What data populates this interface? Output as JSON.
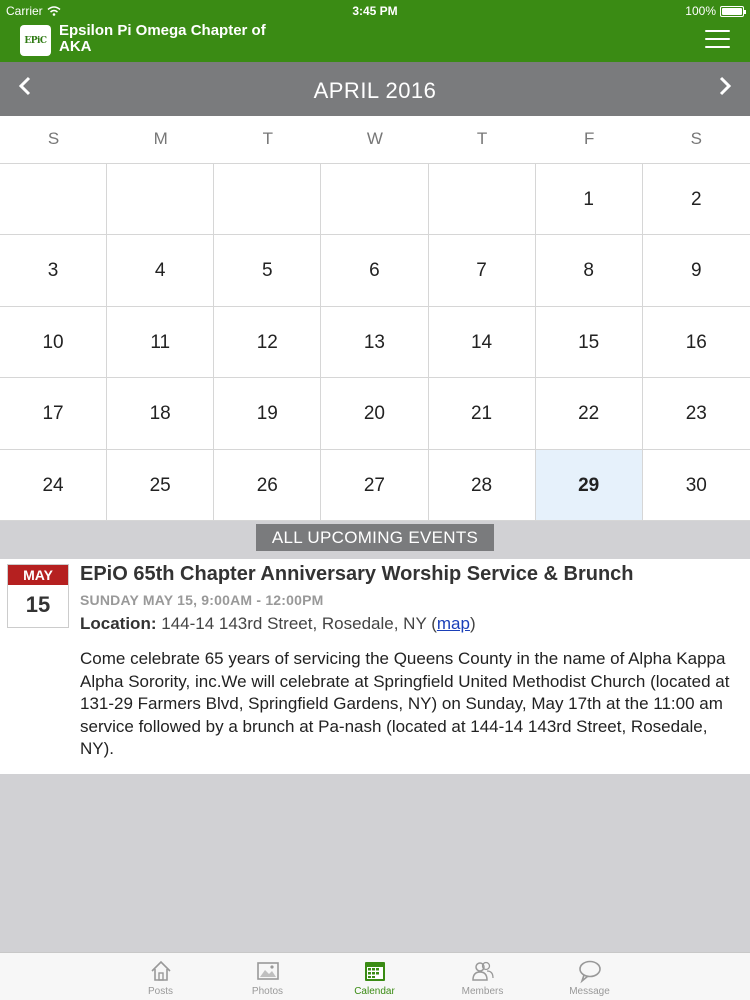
{
  "status_bar": {
    "carrier": "Carrier",
    "time": "3:45 PM",
    "battery": "100%"
  },
  "header": {
    "logo_text": "EPiC",
    "title": "Epsilon Pi Omega Chapter of AKA",
    "accent": "#3a8b14"
  },
  "calendar": {
    "month_label": "APRIL 2016",
    "weekdays": [
      "S",
      "M",
      "T",
      "W",
      "T",
      "F",
      "S"
    ],
    "weeks": [
      [
        "",
        "",
        "",
        "",
        "",
        "1",
        "2"
      ],
      [
        "3",
        "4",
        "5",
        "6",
        "7",
        "8",
        "9"
      ],
      [
        "10",
        "11",
        "12",
        "13",
        "14",
        "15",
        "16"
      ],
      [
        "17",
        "18",
        "19",
        "20",
        "21",
        "22",
        "23"
      ],
      [
        "24",
        "25",
        "26",
        "27",
        "28",
        "29",
        "30"
      ]
    ],
    "selected_day": "29"
  },
  "upcoming": {
    "label": "ALL UPCOMING EVENTS"
  },
  "event": {
    "month": "MAY",
    "day": "15",
    "title": "EPiO 65th Chapter Anniversary Worship Service & Brunch",
    "when": "SUNDAY MAY 15, 9:00AM - 12:00PM",
    "location_label": "Location:",
    "location": "144-14 143rd Street, Rosedale, NY",
    "map_link": "map",
    "description": "Come celebrate 65 years of servicing the Queens County in the name of Alpha Kappa Alpha Sorority, inc.We will celebrate at Springfield United Methodist Church (located at 131-29 Farmers Blvd, Springfield Gardens, NY) on Sunday, May 17th at the 11:00 am service followed by a brunch at Pa-nash (located at 144-14 143rd Street, Rosedale, NY)."
  },
  "tabs": [
    {
      "label": "Posts",
      "icon": "home-icon"
    },
    {
      "label": "Photos",
      "icon": "photo-icon"
    },
    {
      "label": "Calendar",
      "icon": "calendar-icon",
      "active": true
    },
    {
      "label": "Members",
      "icon": "members-icon"
    },
    {
      "label": "Message",
      "icon": "message-icon"
    }
  ]
}
